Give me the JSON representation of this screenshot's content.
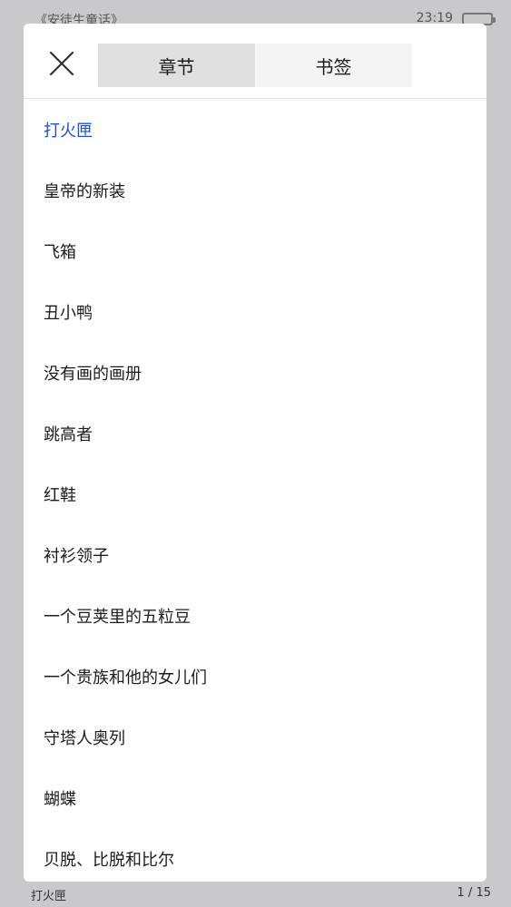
{
  "status_bar": {
    "book_title": "《安徒生童话》",
    "time": "23:19"
  },
  "panel": {
    "tabs": [
      {
        "label": "章节",
        "active": true
      },
      {
        "label": "书签",
        "active": false
      }
    ],
    "chapters": [
      {
        "title": "打火匣",
        "current": true
      },
      {
        "title": "皇帝的新装",
        "current": false
      },
      {
        "title": "飞箱",
        "current": false
      },
      {
        "title": "丑小鸭",
        "current": false
      },
      {
        "title": "没有画的画册",
        "current": false
      },
      {
        "title": "跳高者",
        "current": false
      },
      {
        "title": "红鞋",
        "current": false
      },
      {
        "title": "衬衫领子",
        "current": false
      },
      {
        "title": "一个豆荚里的五粒豆",
        "current": false
      },
      {
        "title": "一个贵族和他的女儿们",
        "current": false
      },
      {
        "title": "守塔人奥列",
        "current": false
      },
      {
        "title": "蝴蝶",
        "current": false
      },
      {
        "title": "贝脱、比脱和比尔",
        "current": false
      }
    ]
  },
  "footer": {
    "chapter": "打火匣",
    "page": "1 / 15"
  },
  "colors": {
    "accent": "#2152c9",
    "overlay": "#c9c9cc"
  }
}
